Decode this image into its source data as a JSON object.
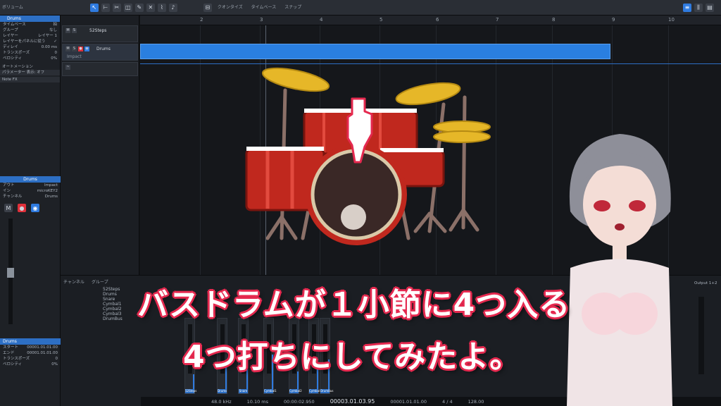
{
  "toolbar": {
    "volume_label": "ボリューム",
    "menu_labels": [
      "クオンタイズ",
      "タイムベース",
      "スナップ"
    ],
    "time_display": "00003.01.03.95",
    "position_display": "00:00:02.950",
    "sample_rate": "48.0 kHz",
    "cpu": "10.10 ms",
    "tempo": "128.00",
    "signature": "4 / 4",
    "end_position": "00001.01.01.00"
  },
  "inspector": {
    "track_header": "Drums",
    "rows": [
      {
        "label": "タイムベース",
        "value": "拍"
      },
      {
        "label": "グループ",
        "value": "なし"
      },
      {
        "label": "レイヤー",
        "value": "レイヤー 1"
      },
      {
        "label": "レイヤーをパネルに従う",
        "value": "✓"
      },
      {
        "label": "ディレイ",
        "value": "0.00 ms"
      },
      {
        "label": "トランスポーズ",
        "value": "0"
      },
      {
        "label": "ベロシティ",
        "value": "0%"
      }
    ],
    "automation_section": "オートメーション",
    "automation_row": "パラメーター  表示: オフ",
    "fx_label": "Note FX",
    "instrument_header": "Drums",
    "instrument_rows": [
      {
        "label": "アウト",
        "value": "Impact"
      },
      {
        "label": "イン",
        "value": "microKEY2"
      },
      {
        "label": "チャンネル",
        "value": "Drums"
      }
    ],
    "bottom_header": "Drums",
    "bottom_rows": [
      {
        "label": "スタート",
        "value": "00001.01.01.00"
      },
      {
        "label": "エンド",
        "value": "00001.01.01.00"
      },
      {
        "label": "トランスポーズ",
        "value": "0"
      },
      {
        "label": "ベロシティ",
        "value": "0%"
      }
    ]
  },
  "tracks": [
    {
      "name": "52Steps"
    },
    {
      "name": "Drums"
    },
    {
      "name": "Impact"
    }
  ],
  "ruler_numbers": [
    "2",
    "3",
    "4",
    "5",
    "6",
    "7",
    "8",
    "9",
    "10"
  ],
  "mixer": {
    "channels": [
      "52Steps",
      "Drums",
      "Snare",
      "Cymbal1",
      "Cymbal2",
      "Cymbal3",
      "DrumBus"
    ],
    "header_labels": [
      "チャンネル",
      "グループ"
    ],
    "meter_levels": [
      0.3,
      0.55,
      0.4,
      0.7,
      0.35,
      0.5,
      0.6
    ],
    "output_label": "Output 1+2"
  },
  "captions": {
    "line1": "バスドラムが１小節に4つ入る",
    "line2": "4つ打ちにしてみたよ。"
  },
  "colors": {
    "accent": "#2f7be0",
    "caption_outline": "#e5294f",
    "clip": "#2a7fe0"
  }
}
